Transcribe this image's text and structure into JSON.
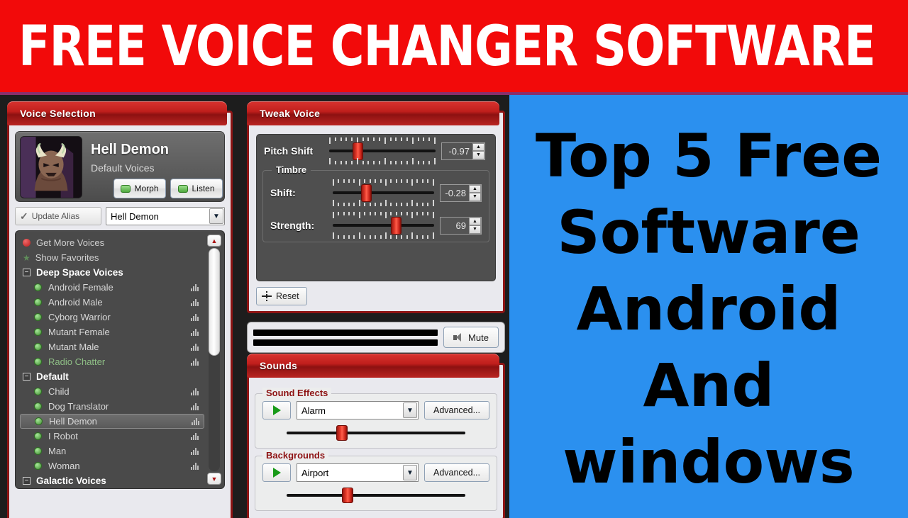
{
  "banner": {
    "title": "FREE VOICE CHANGER SOFTWARE"
  },
  "promo": {
    "lines": [
      "Top 5 Free",
      "Software",
      "Android",
      "And",
      "windows"
    ],
    "bg_color": "#2b90ef",
    "text_color": "#000000"
  },
  "colors": {
    "banner_red": "#f20a0a",
    "panel_red": "#8d1414",
    "title_gradient_top": "#d8332f",
    "accent_green": "#3e8c2f"
  },
  "voice_selection": {
    "title": "Voice Selection",
    "card": {
      "name": "Hell Demon",
      "category": "Default Voices",
      "avatar_icon": "demon-avatar"
    },
    "morph_label": "Morph",
    "listen_label": "Listen",
    "update_alias_label": "Update Alias",
    "alias_value": "Hell Demon",
    "list": [
      {
        "label": "Get More Voices",
        "type": "action",
        "icon": "red-dot-icon"
      },
      {
        "label": "Show Favorites",
        "type": "action",
        "icon": "star-icon"
      },
      {
        "label": "Deep Space Voices",
        "type": "group",
        "expander": "minus"
      },
      {
        "label": "Android Female",
        "type": "item"
      },
      {
        "label": "Android Male",
        "type": "item"
      },
      {
        "label": "Cyborg Warrior",
        "type": "item"
      },
      {
        "label": "Mutant Female",
        "type": "item"
      },
      {
        "label": "Mutant Male",
        "type": "item"
      },
      {
        "label": "Radio Chatter",
        "type": "item",
        "state": "green"
      },
      {
        "label": "Default",
        "type": "group",
        "expander": "minus"
      },
      {
        "label": "Child",
        "type": "item"
      },
      {
        "label": "Dog Translator",
        "type": "item"
      },
      {
        "label": "Hell Demon",
        "type": "item",
        "state": "selected"
      },
      {
        "label": "I Robot",
        "type": "item"
      },
      {
        "label": "Man",
        "type": "item"
      },
      {
        "label": "Woman",
        "type": "item"
      },
      {
        "label": "Galactic Voices",
        "type": "group",
        "expander": "minus"
      }
    ]
  },
  "tweak_voice": {
    "title": "Tweak Voice",
    "pitch_shift": {
      "label": "Pitch Shift",
      "value": "-0.97",
      "knob_pct": 27
    },
    "timbre": {
      "legend": "Timbre",
      "shift": {
        "label": "Shift:",
        "value": "-0.28",
        "knob_pct": 34
      },
      "strength": {
        "label": "Strength:",
        "value": "69",
        "knob_pct": 63
      }
    },
    "reset_label": "Reset"
  },
  "meter": {
    "mute_label": "Mute",
    "channels": 2
  },
  "sounds": {
    "title": "Sounds",
    "sound_effects": {
      "legend": "Sound Effects",
      "selected": "Alarm",
      "advanced_label": "Advanced...",
      "volume_pct": 31
    },
    "backgrounds": {
      "legend": "Backgrounds",
      "selected": "Airport",
      "advanced_label": "Advanced...",
      "volume_pct": 34
    }
  }
}
